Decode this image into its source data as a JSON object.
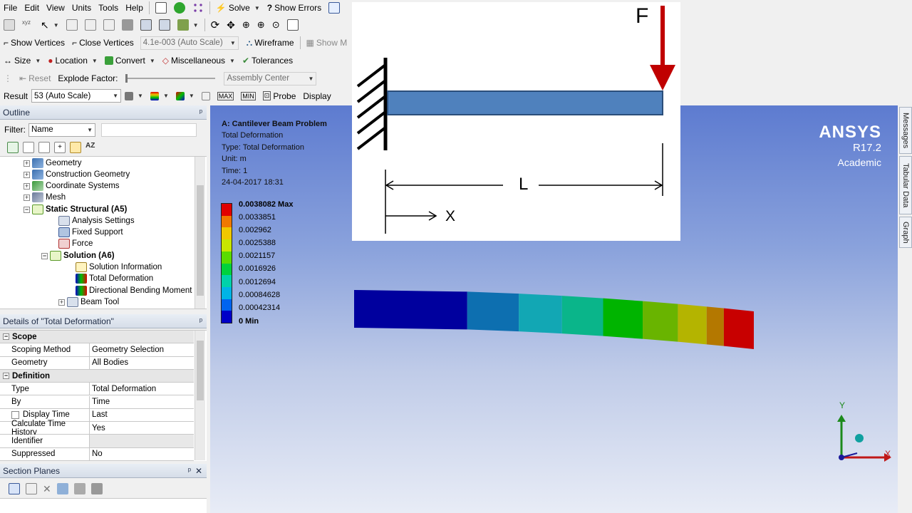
{
  "menu": [
    "File",
    "Edit",
    "View",
    "Units",
    "Tools",
    "Help"
  ],
  "toolbar1": {
    "solve": "Solve",
    "show_errors": "Show Errors"
  },
  "toolbar3": {
    "show_vertices": "Show Vertices",
    "close_vertices": "Close Vertices",
    "scale_value": "4.1e-003 (Auto Scale)",
    "wireframe": "Wireframe",
    "show_m": "Show M"
  },
  "toolbar4": {
    "size": "Size",
    "location": "Location",
    "convert": "Convert",
    "miscellaneous": "Miscellaneous",
    "tolerances": "Tolerances"
  },
  "toolbar5": {
    "reset": "Reset",
    "explode_factor": "Explode Factor:",
    "assembly_center": "Assembly Center"
  },
  "toolbar6": {
    "result_label": "Result",
    "result_value": "53 (Auto Scale)",
    "probe": "Probe",
    "display": "Display"
  },
  "outline": {
    "title": "Outline",
    "filter_label": "Filter:",
    "filter_value": "Name",
    "items": [
      {
        "label": "Geometry"
      },
      {
        "label": "Construction Geometry"
      },
      {
        "label": "Coordinate Systems"
      },
      {
        "label": "Mesh"
      },
      {
        "label": "Static Structural (A5)"
      },
      {
        "label": "Analysis Settings"
      },
      {
        "label": "Fixed Support"
      },
      {
        "label": "Force"
      },
      {
        "label": "Solution (A6)"
      },
      {
        "label": "Solution Information"
      },
      {
        "label": "Total Deformation"
      },
      {
        "label": "Directional Bending Moment"
      },
      {
        "label": "Beam Tool"
      }
    ]
  },
  "details": {
    "title": "Details of \"Total Deformation\"",
    "scope_header": "Scope",
    "definition_header": "Definition",
    "rows": [
      {
        "k": "Scoping Method",
        "v": "Geometry Selection"
      },
      {
        "k": "Geometry",
        "v": "All Bodies"
      },
      {
        "k": "Type",
        "v": "Total Deformation"
      },
      {
        "k": "By",
        "v": "Time"
      },
      {
        "k": "Display Time",
        "v": "Last"
      },
      {
        "k": "Calculate Time History",
        "v": "Yes"
      },
      {
        "k": "Identifier",
        "v": ""
      },
      {
        "k": "Suppressed",
        "v": "No"
      }
    ]
  },
  "section_planes": {
    "title": "Section Planes"
  },
  "viewport": {
    "header": [
      "A: Cantilever Beam Problem",
      "Total Deformation",
      "Type: Total Deformation",
      "Unit: m",
      "Time: 1",
      "24-04-2017 18:31"
    ],
    "brand": {
      "name": "ANSYS",
      "version": "R17.2",
      "edition": "Academic"
    },
    "legend": [
      "0.0038082 Max",
      "0.0033851",
      "0.002962",
      "0.0025388",
      "0.0021157",
      "0.0016926",
      "0.0012694",
      "0.00084628",
      "0.00042314",
      "0 Min"
    ],
    "legend_colors": [
      "#e00000",
      "#f07800",
      "#f0c800",
      "#c8e600",
      "#5adc00",
      "#00d23c",
      "#00d2aa",
      "#00b4e6",
      "#0064f0",
      "#0000c8"
    ],
    "triad": {
      "x": "X",
      "y": "Y"
    }
  },
  "beam_colors": [
    "#00009e",
    "#0d6fb0",
    "#12a7b4",
    "#0ab58a",
    "#00b400",
    "#69b400",
    "#b4b400",
    "#b47800",
    "#c80000"
  ],
  "diagram": {
    "force": "F",
    "length": "L",
    "axis": "X"
  },
  "side_tabs": [
    "Messages",
    "Tabular Data",
    "Graph"
  ]
}
